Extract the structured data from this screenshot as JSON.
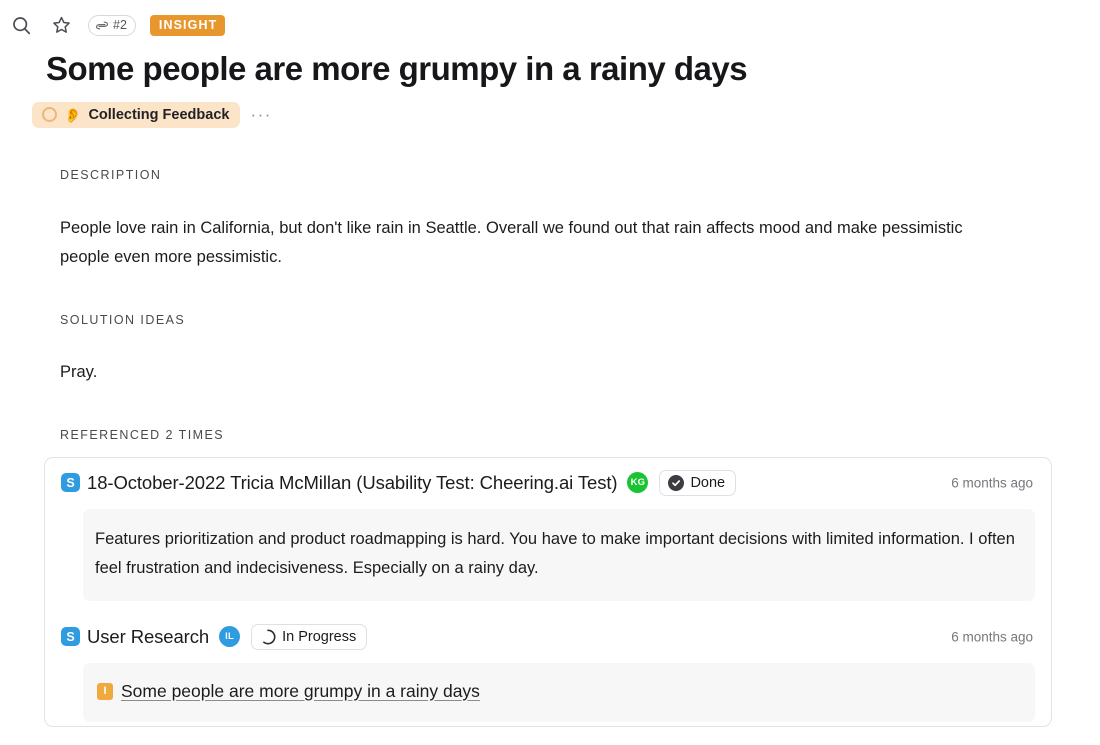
{
  "topbar": {
    "search_icon": "search-icon",
    "star_icon": "star-icon",
    "reference_pill": {
      "icon": "loop-link-icon",
      "label": "#2"
    },
    "type_badge": "INSIGHT"
  },
  "header": {
    "title": "Some people are more grumpy in a rainy days",
    "status": {
      "ring_icon": "empty-circle-icon",
      "emoji": "👂",
      "label": "Collecting Feedback",
      "ring_color": "#e9b87c",
      "background": "#fbe4c7"
    },
    "more_button": "···"
  },
  "sections": {
    "description": {
      "label": "DESCRIPTION",
      "text": "People love rain in California, but don't like rain in Seattle. Overall we found out that rain affects mood and make pessimistic people even more pessimistic."
    },
    "solution_ideas": {
      "label": "SOLUTION IDEAS",
      "text": "Pray."
    },
    "referenced": {
      "label": "REFERENCED 2 TIMES"
    }
  },
  "references": [
    {
      "source_icon": "S",
      "title": "18-October-2022 Tricia McMillan (Usability Test: Cheering.ai Test)",
      "avatar": {
        "initials": "KG",
        "color": "#18c432"
      },
      "state": {
        "icon": "check-circle-icon",
        "label": "Done"
      },
      "timestamp": "6 months ago",
      "quote": "Features prioritization and product roadmapping is hard. You have to make important decisions with limited information. I often feel frustration and indecisiveness. Especially on a rainy day."
    },
    {
      "source_icon": "S",
      "title": "User Research",
      "avatar": {
        "initials": "IL",
        "color": "#2f9be0"
      },
      "state": {
        "icon": "progress-arc-icon",
        "label": "In Progress"
      },
      "timestamp": "6 months ago",
      "linked_insight": {
        "badge": "I",
        "label": "Some people are more grumpy in a rainy days",
        "badge_color": "#f0a93c"
      }
    }
  ]
}
